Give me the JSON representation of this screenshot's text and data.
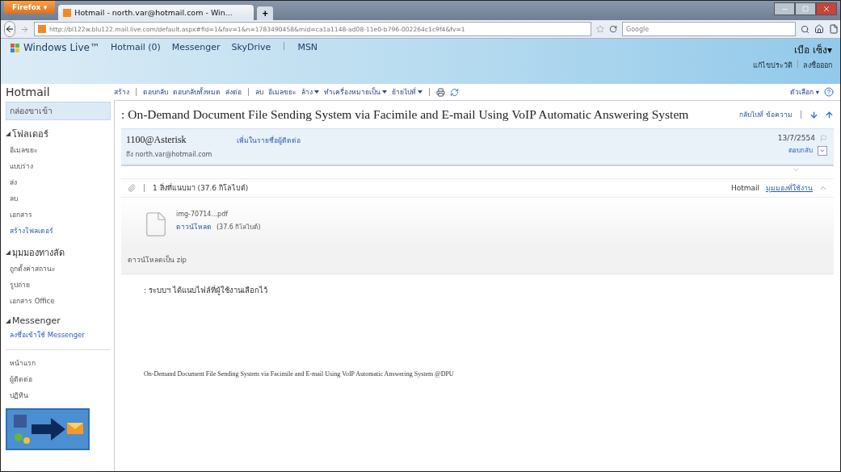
{
  "browser": {
    "firefox_button": "Firefox ▾",
    "tab_title": "Hotmail - north.var@hotmail.com - Win...",
    "new_tab": "+",
    "url": "http://bl122w.blu122.mail.live.com/default.aspx#fid=1&fav=1&n=1783490458&mid=ca1a1148-ad08-11e0-b796-002264c1c9f4&fv=1",
    "search_placeholder": "Google"
  },
  "live_nav": {
    "brand": "Windows Live™",
    "links": [
      "Hotmail (0)",
      "Messenger",
      "SkyDrive",
      "MSN"
    ],
    "user_name": "เบือ เซ็ง▾",
    "profile_links": [
      "แก้ไขประวัติ",
      "ลงชื่อออก"
    ]
  },
  "toolbar": {
    "title": "Hotmail",
    "groups": [
      [
        {
          "label": "สร้าง",
          "dropdown": false
        }
      ],
      [
        {
          "label": "ตอบกลับ",
          "dropdown": false
        },
        {
          "label": "ตอบกลับทั้งหมด",
          "dropdown": false
        },
        {
          "label": "ส่งต่อ",
          "dropdown": false
        }
      ],
      [
        {
          "label": "ลบ",
          "dropdown": false
        },
        {
          "label": "อีเมลขยะ",
          "dropdown": false
        },
        {
          "label": "ล้าง",
          "dropdown": true
        },
        {
          "label": "ทำเครื่องหมายเป็น",
          "dropdown": true
        },
        {
          "label": "ย้ายไปที่",
          "dropdown": true
        }
      ]
    ],
    "options": "ตัวเลือก ▾"
  },
  "sidebar": {
    "sections": [
      {
        "items": [
          {
            "label": "กล่องขาเข้า",
            "kind": "plain",
            "selected": true
          }
        ]
      },
      {
        "title": "โฟลเดอร์",
        "items": [
          {
            "label": "อีเมลขยะ",
            "kind": "plain",
            "selected": false
          },
          {
            "label": "แบบร่าง",
            "kind": "plain",
            "selected": false
          },
          {
            "label": "ส่ง",
            "kind": "plain",
            "selected": false
          },
          {
            "label": "ลบ",
            "kind": "plain",
            "selected": false
          },
          {
            "label": "เอกสาร",
            "kind": "plain",
            "selected": false
          },
          {
            "label": "สร้างโฟลเดอร์",
            "kind": "link",
            "selected": false
          }
        ]
      },
      {
        "title": "มุมมองทางลัด",
        "items": [
          {
            "label": "ถูกตั้งค่าสถานะ",
            "kind": "plain",
            "selected": false
          },
          {
            "label": "รูปถ่าย",
            "kind": "plain",
            "selected": false
          },
          {
            "label": "เอกสาร Office",
            "kind": "plain",
            "selected": false
          }
        ]
      },
      {
        "title": "Messenger",
        "items": [
          {
            "label": "ลงชื่อเข้าใช้ Messenger",
            "kind": "link",
            "selected": false
          }
        ]
      }
    ],
    "bottom_items": [
      "หน้าแรก",
      "ผู้ติดต่อ",
      "ปฏิทิน"
    ],
    "banner": {
      "kind": "picture"
    }
  },
  "message": {
    "subject": ": On-Demand Document File Sending System via Facimile and E-mail Using VoIP Automatic Answering System",
    "back_link": "กลับไปที่ ข้อความ",
    "sender": "1100@Asterisk",
    "add_contact": "เพิ่มในรายชื่อผู้ติดต่อ",
    "to": "ถึง north.var@hotmail.com",
    "date": "13/7/2554",
    "reply": "ตอบกลับ",
    "attachment_summary": "1 สิ่งที่แนบมา (37.6 กิโลไบต์)",
    "view_prefix": "Hotmail",
    "view_link": "มุมมองที่ใช้งาน",
    "file_name": "img-70714...pdf",
    "download": "ดาวน์โหลด",
    "file_size": "(37.6 กิโลไบต์)",
    "zip_link": "ดาวน์โหลดเป็น zip",
    "body_intro": ": ระบบฯ ได้แนบไฟล์ที่ผู้ใช้งานเลือกไว้",
    "body_footer": "On-Demand Document File Sending System via Facimile and E-mail Using VoIP Automatic Answering System @DPU"
  }
}
